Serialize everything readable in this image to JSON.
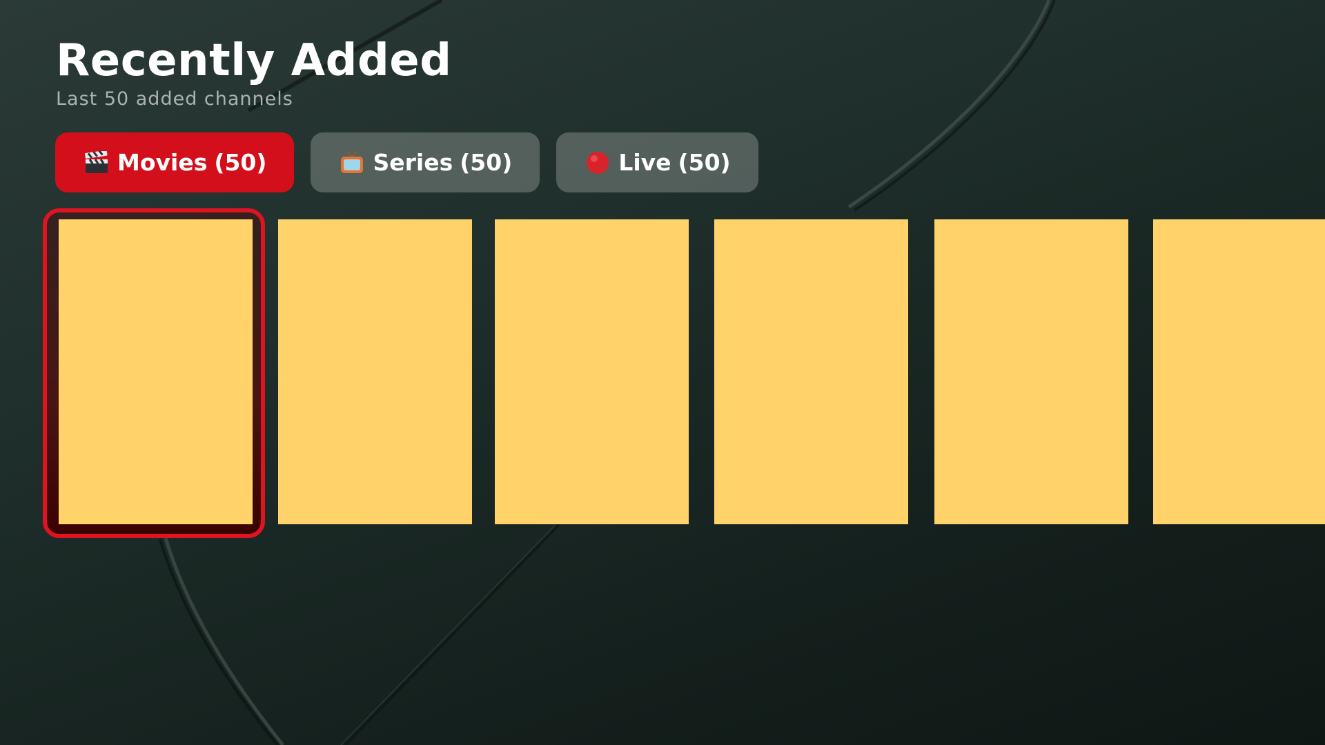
{
  "header": {
    "title": "Recently Added",
    "subtitle": "Last 50 added channels"
  },
  "tabs": [
    {
      "icon": "clapperboard-icon",
      "label": "Movies",
      "count": "(50)",
      "active": true
    },
    {
      "icon": "tv-icon",
      "label": "Series",
      "count": "(50)",
      "active": false
    },
    {
      "icon": "red-circle-icon",
      "label": "Live",
      "count": "(50)",
      "active": false
    }
  ],
  "cards": {
    "selected_index": 0,
    "placeholder_color": "#ffd369",
    "focus_color": "#e01321"
  },
  "colors": {
    "accent": "#d30f1b",
    "tab_inactive": "#6e7774",
    "background": "#1f2f2b"
  }
}
